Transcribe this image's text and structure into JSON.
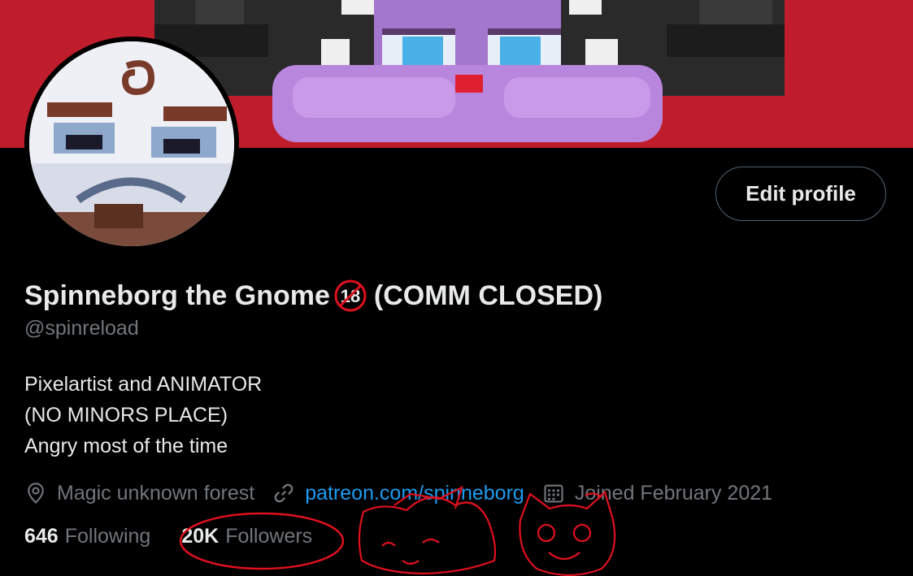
{
  "profile": {
    "display_name": "Spinneborg the Gnome",
    "name_suffix": "(COMM CLOSED)",
    "handle": "@spinreload",
    "bio_lines": [
      "Pixelartist and ANIMATOR",
      "(NO MINORS PLACE)",
      "Angry most of the time"
    ],
    "location": "Magic unknown forest",
    "link": "patreon.com/spinneborg",
    "joined": "Joined February 2021"
  },
  "actions": {
    "edit_profile_label": "Edit profile"
  },
  "stats": {
    "following_count": "646",
    "following_label": "Following",
    "followers_count": "20K",
    "followers_label": "Followers"
  },
  "colors": {
    "banner_red": "#c01d2c",
    "link_blue": "#1d9bf0",
    "muted_text": "#71767b",
    "scribble_red": "#e0101e"
  },
  "icons": {
    "location": "map-pin-icon",
    "link": "link-icon",
    "joined": "calendar-icon",
    "badge": "no-under-18-icon"
  }
}
